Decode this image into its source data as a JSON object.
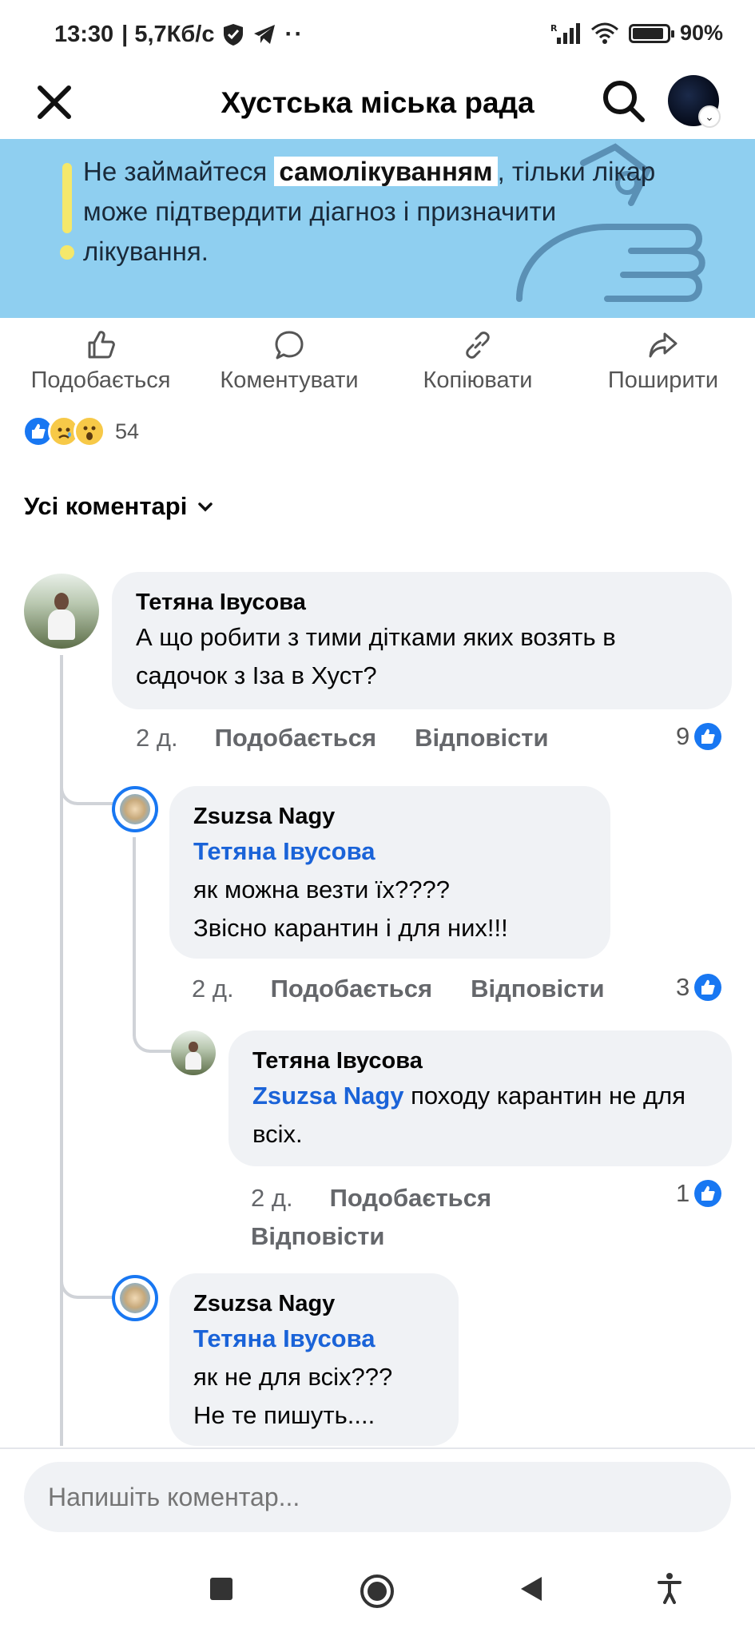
{
  "status_bar": {
    "time": "13:30",
    "network_speed": "| 5,7Кб/с",
    "battery": "90%",
    "battery_level": 0.9
  },
  "header": {
    "title": "Хустська міська рада"
  },
  "banner": {
    "text_before": "Не займайтеся ",
    "highlight": "самолікуванням",
    "text_after": ", тільки лікар може підтвердити діагноз і призначити лікування."
  },
  "actions": {
    "like": "Подобається",
    "comment": "Коментувати",
    "copy": "Копіювати",
    "share": "Поширити"
  },
  "reactions": {
    "count": "54"
  },
  "filter": {
    "label": "Усі коментарі"
  },
  "comments": [
    {
      "author": "Тетяна Івусова",
      "text": "А що робити з тими дітками яких возять в садочок з Іза в Хуст?",
      "time": "2 д.",
      "like_label": "Подобається",
      "reply_label": "Відповісти",
      "likes": "9"
    },
    {
      "author": "Zsuzsa Nagy",
      "tag": "Тетяна Івусова",
      "line1": "як можна везти їх????",
      "line2": "Звісно карантин і для них!!!",
      "time": "2 д.",
      "like_label": "Подобається",
      "reply_label": "Відповісти",
      "likes": "3"
    },
    {
      "author": "Тетяна Івусова",
      "tag": "Zsuzsa Nagy",
      "text": " походу карантин не для всіх.",
      "time": "2 д.",
      "like_label": "Подобається",
      "reply_label": "Відповісти",
      "likes": "1"
    },
    {
      "author": "Zsuzsa Nagy",
      "tag": "Тетяна Івусова",
      "line1": "як не для всіх???",
      "line2": "Не те пишуть...."
    }
  ],
  "composer": {
    "placeholder": "Напишіть коментар..."
  },
  "colors": {
    "accent": "#1877f2",
    "banner_bg": "#8fcff0",
    "bubble_bg": "#f0f2f5",
    "tag": "#1a63d8"
  }
}
